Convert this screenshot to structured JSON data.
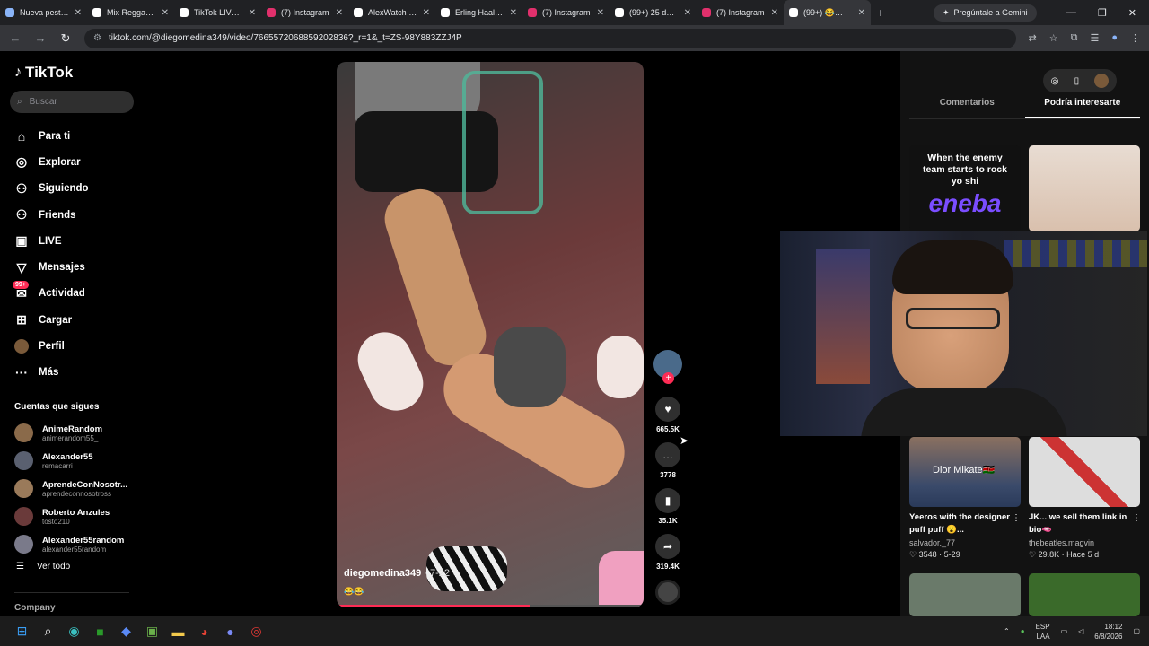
{
  "browser": {
    "tabs": [
      {
        "title": "Nueva pestaña",
        "color": "#8ab4f8"
      },
      {
        "title": "Mix Reggaetón",
        "color": "#ffffff"
      },
      {
        "title": "TikTok LIVE In",
        "color": "#ffffff"
      },
      {
        "title": "(7) Instagram",
        "color": "#e1306c"
      },
      {
        "title": "AlexWatch (@",
        "color": "#ffffff"
      },
      {
        "title": "Erling Haaland",
        "color": "#ffffff"
      },
      {
        "title": "(7) Instagram",
        "color": "#e1306c"
      },
      {
        "title": "(99+) 25 de se",
        "color": "#ffffff"
      },
      {
        "title": "(7) Instagram",
        "color": "#e1306c"
      },
      {
        "title": "(99+) 😂😂😂",
        "color": "#ffffff"
      }
    ],
    "gemini_label": "Pregúntale a Gemini",
    "url": "tiktok.com/@diegomedina349/video/7665572068859202836?_r=1&_t=ZS-98Y883ZZJ4P"
  },
  "sidebar": {
    "brand": "TikTok",
    "search_placeholder": "Buscar",
    "nav": [
      {
        "label": "Para ti",
        "icon": "⌂"
      },
      {
        "label": "Explorar",
        "icon": "◎"
      },
      {
        "label": "Siguiendo",
        "icon": "⚇"
      },
      {
        "label": "Friends",
        "icon": "⚇"
      },
      {
        "label": "LIVE",
        "icon": "▣"
      },
      {
        "label": "Mensajes",
        "icon": "▽"
      },
      {
        "label": "Actividad",
        "icon": "✉"
      },
      {
        "label": "Cargar",
        "icon": "⊞"
      },
      {
        "label": "Perfil",
        "icon": ""
      },
      {
        "label": "Más",
        "icon": "···"
      }
    ],
    "activity_badge": "99+",
    "following_title": "Cuentas que sigues",
    "following": [
      {
        "name": "AnimeRandom",
        "user": "animerandom55_",
        "color": "#8a6a4a"
      },
      {
        "name": "Alexander55",
        "user": "remacarri",
        "color": "#5a6070"
      },
      {
        "name": "AprendeConNosotr...",
        "user": "aprendeconnosotross",
        "color": "#9a7a5a"
      },
      {
        "name": "Roberto Anzules",
        "user": "tosto210",
        "color": "#6a3a3a"
      },
      {
        "name": "Alexander55random",
        "user": "alexander55random",
        "color": "#7a7a8a"
      }
    ],
    "see_all": "Ver todo",
    "company": "Company"
  },
  "video": {
    "username": "diegomedina349",
    "date": " · 7-22",
    "caption": "😂😂",
    "progress": 0.63,
    "likes": "665.5K",
    "comments": "3778",
    "saves": "35.1K",
    "shares": "319.4K"
  },
  "right_panel": {
    "tab_comments": "Comentarios",
    "tab_interest": "Podría interesarte",
    "top_card_text": "When the enemy team starts to rock yo shi",
    "top_card_brand": "eneba",
    "cards": [
      {
        "overlay": "Dior Mikate🇰🇪",
        "title": "Yeeros with the designer puff puff 😮...",
        "user": "salvador._77",
        "likes": "3548",
        "date": "5-29"
      },
      {
        "overlay": "",
        "title": "JK... we sell them link in bio🫦",
        "user": "thebeatles.magvin",
        "likes": "29.8K",
        "date": "Hace 5 d"
      }
    ]
  },
  "taskbar": {
    "lang": "ESP",
    "region": "LAA",
    "time": "18:12",
    "date": "6/8/2026"
  }
}
